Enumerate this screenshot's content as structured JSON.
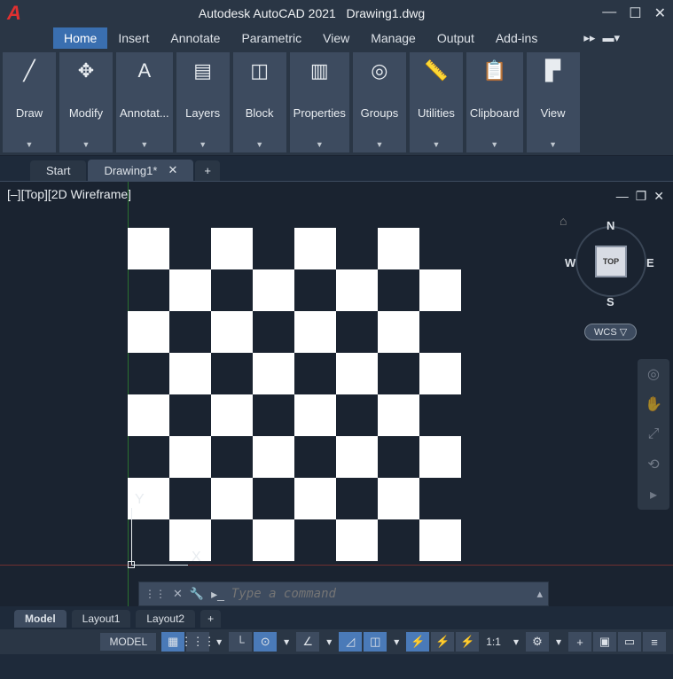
{
  "title": {
    "app": "Autodesk AutoCAD 2021",
    "file": "Drawing1.dwg"
  },
  "menu": {
    "items": [
      "Home",
      "Insert",
      "Annotate",
      "Parametric",
      "View",
      "Manage",
      "Output",
      "Add-ins"
    ],
    "active": "Home"
  },
  "ribbon": [
    {
      "label": "Draw",
      "icon": "╱"
    },
    {
      "label": "Modify",
      "icon": "✥"
    },
    {
      "label": "Annotat...",
      "icon": "A"
    },
    {
      "label": "Layers",
      "icon": "▤"
    },
    {
      "label": "Block",
      "icon": "◫"
    },
    {
      "label": "Properties",
      "icon": "▥"
    },
    {
      "label": "Groups",
      "icon": "◎"
    },
    {
      "label": "Utilities",
      "icon": "📏"
    },
    {
      "label": "Clipboard",
      "icon": "📋"
    },
    {
      "label": "View",
      "icon": "▛"
    }
  ],
  "filetabs": {
    "start": "Start",
    "active": "Drawing1*"
  },
  "viewport": {
    "label": "[–][Top][2D Wireframe]",
    "cube": {
      "n": "N",
      "s": "S",
      "e": "E",
      "w": "W",
      "face": "TOP"
    },
    "wcs": "WCS ▽",
    "ucs": {
      "x": "X",
      "y": "Y"
    }
  },
  "command": {
    "placeholder": "Type a command"
  },
  "layouts": {
    "model": "Model",
    "l1": "Layout1",
    "l2": "Layout2"
  },
  "status": {
    "model": "MODEL",
    "scale": "1:1"
  },
  "chart_data": {
    "type": "grid",
    "description": "8x8 checkerboard pattern drawn on canvas",
    "rows": 8,
    "cols": 8,
    "cell_colors": [
      "white",
      "dark"
    ],
    "pattern": "alternating"
  }
}
